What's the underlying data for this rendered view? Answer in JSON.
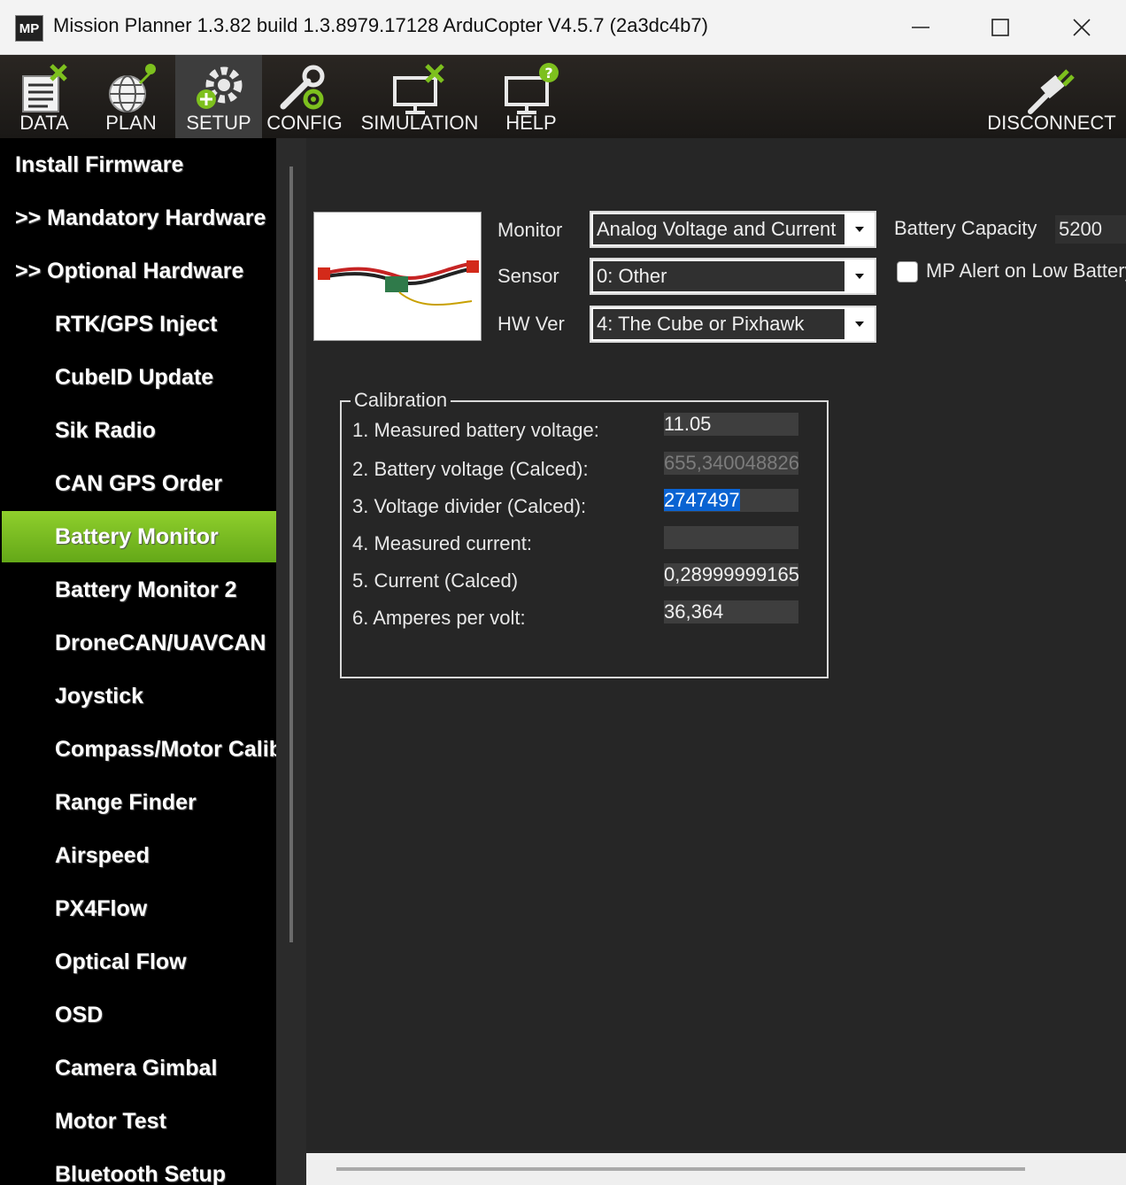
{
  "window": {
    "icon_text": "MP",
    "title": "Mission Planner 1.3.82 build 1.3.8979.17128 ArduCopter V4.5.7 (2a3dc4b7)"
  },
  "toolbar": {
    "data": "DATA",
    "plan": "PLAN",
    "setup": "SETUP",
    "config": "CONFIG",
    "simulation": "SIMULATION",
    "help": "HELP",
    "disconnect": "DISCONNECT"
  },
  "sidebar": {
    "items": [
      "Install Firmware",
      ">> Mandatory Hardware",
      ">> Optional Hardware",
      "RTK/GPS Inject",
      "CubeID Update",
      "Sik Radio",
      "CAN GPS Order",
      "Battery Monitor",
      "Battery Monitor 2",
      "DroneCAN/UAVCAN",
      "Joystick",
      "Compass/Motor Calib",
      "Range Finder",
      "Airspeed",
      "PX4Flow",
      "Optical Flow",
      "OSD",
      "Camera Gimbal",
      "Motor Test",
      "Bluetooth Setup"
    ],
    "active_index": 7,
    "accent_color": "#7dbd23"
  },
  "battery": {
    "monitor_label": "Monitor",
    "monitor_value": "Analog Voltage and Current",
    "sensor_label": "Sensor",
    "sensor_value": "0: Other",
    "hwver_label": "HW Ver",
    "hwver_value": "4: The Cube or Pixhawk",
    "capacity_label": "Battery Capacity",
    "capacity_value": "5200",
    "alert_label": "MP Alert on Low Battery",
    "alert_checked": false
  },
  "calibration": {
    "title": "Calibration",
    "rows": [
      {
        "label": "1. Measured battery voltage:",
        "value": "11.05"
      },
      {
        "label": "2. Battery voltage (Calced):",
        "value": "655,340048826"
      },
      {
        "label": "3. Voltage divider (Calced):",
        "value": "2747497"
      },
      {
        "label": "4. Measured current:",
        "value": ""
      },
      {
        "label": "5. Current (Calced)",
        "value": "0,28999999165"
      },
      {
        "label": "6. Amperes per volt:",
        "value": "36,364"
      }
    ]
  }
}
